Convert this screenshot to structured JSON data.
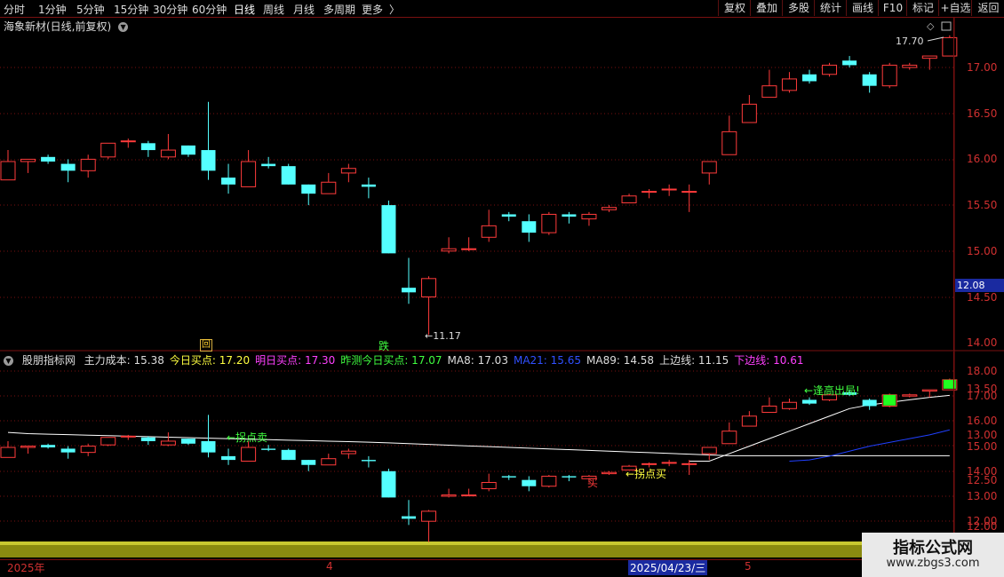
{
  "toolbar": {
    "periods": [
      "分时",
      "1分钟",
      "5分钟",
      "15分钟",
      "30分钟",
      "60分钟",
      "日线",
      "周线",
      "月线",
      "多周期",
      "更多"
    ],
    "active_period": "日线",
    "more_chevron": "〉",
    "buttons": [
      "复权",
      "叠加",
      "多股",
      "统计",
      "画线",
      "F10",
      "标记",
      "+自选",
      "返回"
    ]
  },
  "stock_title": "海象新材(日线,前复权)",
  "upper_axis": {
    "ticks": [
      "17.00",
      "16.50",
      "16.00",
      "15.50",
      "15.00",
      "14.50",
      "14.00",
      "13.50",
      "13.00",
      "12.50",
      "12.00"
    ],
    "current_price_tag": "12.08",
    "high_label": "17.70",
    "low_label": "11.17"
  },
  "markers": {
    "hui": "回",
    "die": "跌"
  },
  "indicator": {
    "name": "股朋指标网",
    "items": [
      {
        "text": "主力成本: 15.38",
        "color": "#dddddd"
      },
      {
        "text": "今日买点: 17.20",
        "color": "#ffff40"
      },
      {
        "text": "明日买点: 17.30",
        "color": "#ff40ff"
      },
      {
        "text": "昨测今日买点: 17.07",
        "color": "#40ff40"
      },
      {
        "text": "MA8: 17.03",
        "color": "#dddddd"
      },
      {
        "text": "MA21: 15.65",
        "color": "#3050ff"
      },
      {
        "text": "MA89: 14.58",
        "color": "#dddddd"
      },
      {
        "text": "上边线: 11.15",
        "color": "#dddddd"
      },
      {
        "text": "下边线: 10.61",
        "color": "#ff40ff"
      }
    ],
    "annotations": {
      "guaidian_mai": "←拐点卖",
      "guaidian_mai2": "←拐点买",
      "mai": "买",
      "fenggao": "←逢高出局!"
    }
  },
  "lower_axis": {
    "ticks": [
      "18.00",
      "17.00",
      "16.00",
      "15.00",
      "14.00",
      "13.00",
      "12.00"
    ]
  },
  "time_axis": {
    "labels": [
      "2025年",
      "4",
      "2025/04/23/三",
      "5"
    ]
  },
  "watermark": {
    "line1": "指标公式网",
    "line2": "www.zbgs3.com"
  },
  "colors": {
    "up": "#ff3b3b",
    "down": "#54ffff",
    "grid": "#7a1010",
    "ma": "#ffffff",
    "ma21": "#2040ff"
  },
  "chart_data": {
    "type": "candlestick",
    "ylim_upper": [
      11.0,
      18.0
    ],
    "ylim_lower": [
      11.5,
      18.3
    ],
    "candles": [
      {
        "o": 14.55,
        "h": 15.2,
        "l": 14.55,
        "c": 14.95
      },
      {
        "o": 14.95,
        "h": 15.0,
        "l": 14.7,
        "c": 15.0
      },
      {
        "o": 15.05,
        "h": 15.1,
        "l": 14.9,
        "c": 14.95
      },
      {
        "o": 14.9,
        "h": 15.0,
        "l": 14.5,
        "c": 14.75
      },
      {
        "o": 14.75,
        "h": 15.1,
        "l": 14.6,
        "c": 15.0
      },
      {
        "o": 15.05,
        "h": 15.35,
        "l": 15.0,
        "c": 15.35
      },
      {
        "o": 15.4,
        "h": 15.45,
        "l": 15.25,
        "c": 15.4
      },
      {
        "o": 15.35,
        "h": 15.4,
        "l": 15.05,
        "c": 15.2
      },
      {
        "o": 15.05,
        "h": 15.55,
        "l": 15.0,
        "c": 15.2
      },
      {
        "o": 15.3,
        "h": 15.3,
        "l": 15.05,
        "c": 15.1
      },
      {
        "o": 15.2,
        "h": 16.25,
        "l": 14.55,
        "c": 14.75
      },
      {
        "o": 14.6,
        "h": 14.9,
        "l": 14.25,
        "c": 14.45
      },
      {
        "o": 14.4,
        "h": 15.2,
        "l": 14.4,
        "c": 14.95
      },
      {
        "o": 14.9,
        "h": 15.05,
        "l": 14.8,
        "c": 14.85
      },
      {
        "o": 14.85,
        "h": 14.9,
        "l": 14.45,
        "c": 14.45
      },
      {
        "o": 14.45,
        "h": 14.45,
        "l": 14.0,
        "c": 14.25
      },
      {
        "o": 14.25,
        "h": 14.7,
        "l": 14.25,
        "c": 14.5
      },
      {
        "o": 14.7,
        "h": 14.9,
        "l": 14.5,
        "c": 14.8
      },
      {
        "o": 14.45,
        "h": 14.6,
        "l": 14.15,
        "c": 14.4
      },
      {
        "o": 14.0,
        "h": 14.1,
        "l": 12.95,
        "c": 12.95
      },
      {
        "o": 12.2,
        "h": 12.85,
        "l": 11.85,
        "c": 12.1
      },
      {
        "o": 12.0,
        "h": 12.45,
        "l": 11.17,
        "c": 12.4
      },
      {
        "o": 13.0,
        "h": 13.3,
        "l": 12.95,
        "c": 13.05
      },
      {
        "o": 13.05,
        "h": 13.3,
        "l": 13.0,
        "c": 13.05
      },
      {
        "o": 13.3,
        "h": 13.9,
        "l": 13.2,
        "c": 13.55
      },
      {
        "o": 13.8,
        "h": 13.85,
        "l": 13.65,
        "c": 13.75
      },
      {
        "o": 13.65,
        "h": 13.8,
        "l": 13.2,
        "c": 13.4
      },
      {
        "o": 13.4,
        "h": 13.85,
        "l": 13.35,
        "c": 13.8
      },
      {
        "o": 13.8,
        "h": 13.85,
        "l": 13.6,
        "c": 13.75
      },
      {
        "o": 13.7,
        "h": 13.85,
        "l": 13.55,
        "c": 13.8
      },
      {
        "o": 13.9,
        "h": 14.0,
        "l": 13.85,
        "c": 13.95
      },
      {
        "o": 14.05,
        "h": 14.25,
        "l": 14.05,
        "c": 14.2
      },
      {
        "o": 14.3,
        "h": 14.35,
        "l": 14.15,
        "c": 14.3
      },
      {
        "o": 14.35,
        "h": 14.45,
        "l": 14.2,
        "c": 14.35
      },
      {
        "o": 14.3,
        "h": 14.45,
        "l": 13.85,
        "c": 14.3
      },
      {
        "o": 14.7,
        "h": 14.95,
        "l": 14.45,
        "c": 14.95
      },
      {
        "o": 15.1,
        "h": 15.95,
        "l": 15.1,
        "c": 15.6
      },
      {
        "o": 15.8,
        "h": 16.4,
        "l": 15.8,
        "c": 16.2
      },
      {
        "o": 16.35,
        "h": 16.95,
        "l": 16.35,
        "c": 16.6
      },
      {
        "o": 16.5,
        "h": 16.9,
        "l": 16.45,
        "c": 16.75
      },
      {
        "o": 16.85,
        "h": 16.95,
        "l": 16.65,
        "c": 16.7
      },
      {
        "o": 16.85,
        "h": 17.1,
        "l": 16.8,
        "c": 17.05
      },
      {
        "o": 17.15,
        "h": 17.25,
        "l": 17.0,
        "c": 17.05
      },
      {
        "o": 16.85,
        "h": 16.9,
        "l": 16.45,
        "c": 16.6
      },
      {
        "o": 16.6,
        "h": 17.1,
        "l": 16.55,
        "c": 17.05
      },
      {
        "o": 17.0,
        "h": 17.1,
        "l": 16.95,
        "c": 17.05
      },
      {
        "o": 17.2,
        "h": 17.2,
        "l": 16.95,
        "c": 17.25
      },
      {
        "o": 17.25,
        "h": 17.7,
        "l": 17.25,
        "c": 17.65
      }
    ],
    "ma_line": [
      15.55,
      15.5,
      15.48,
      15.46,
      15.44,
      15.42,
      15.4,
      15.38,
      15.36,
      15.34,
      15.32,
      15.3,
      15.28,
      15.26,
      15.24,
      15.22,
      15.2,
      15.18,
      15.16,
      15.13,
      15.1,
      15.07,
      15.04,
      15.01,
      14.98,
      14.95,
      14.92,
      14.89,
      14.86,
      14.83,
      14.8,
      14.77,
      14.74,
      14.71,
      14.68,
      14.65,
      14.62,
      14.62,
      14.62,
      14.62,
      14.62,
      14.62,
      14.62,
      14.62,
      14.62,
      14.62,
      14.62,
      14.62
    ],
    "ma8": [
      null,
      null,
      null,
      null,
      null,
      null,
      null,
      null,
      null,
      null,
      null,
      null,
      null,
      null,
      null,
      null,
      null,
      null,
      null,
      null,
      null,
      null,
      null,
      null,
      null,
      null,
      null,
      null,
      null,
      null,
      null,
      null,
      null,
      null,
      14.4,
      14.4,
      14.7,
      15.0,
      15.3,
      15.6,
      15.9,
      16.2,
      16.5,
      16.65,
      16.75,
      16.85,
      16.95,
      17.03
    ],
    "ma21": [
      null,
      null,
      null,
      null,
      null,
      null,
      null,
      null,
      null,
      null,
      null,
      null,
      null,
      null,
      null,
      null,
      null,
      null,
      null,
      null,
      null,
      null,
      null,
      null,
      null,
      null,
      null,
      null,
      null,
      null,
      null,
      null,
      null,
      null,
      null,
      null,
      null,
      null,
      null,
      14.4,
      14.45,
      14.6,
      14.8,
      15.0,
      15.15,
      15.3,
      15.45,
      15.65
    ],
    "ma89": [
      null,
      null,
      null,
      null,
      null,
      null,
      null,
      null,
      null,
      null,
      null,
      null,
      null,
      null,
      null,
      null,
      null,
      null,
      null,
      null,
      null,
      null,
      null,
      null,
      null,
      null,
      null,
      null,
      null,
      null,
      null,
      null,
      null,
      null,
      null,
      null,
      null,
      null,
      null,
      null,
      null,
      null,
      null,
      null,
      null,
      null,
      null,
      null
    ]
  }
}
